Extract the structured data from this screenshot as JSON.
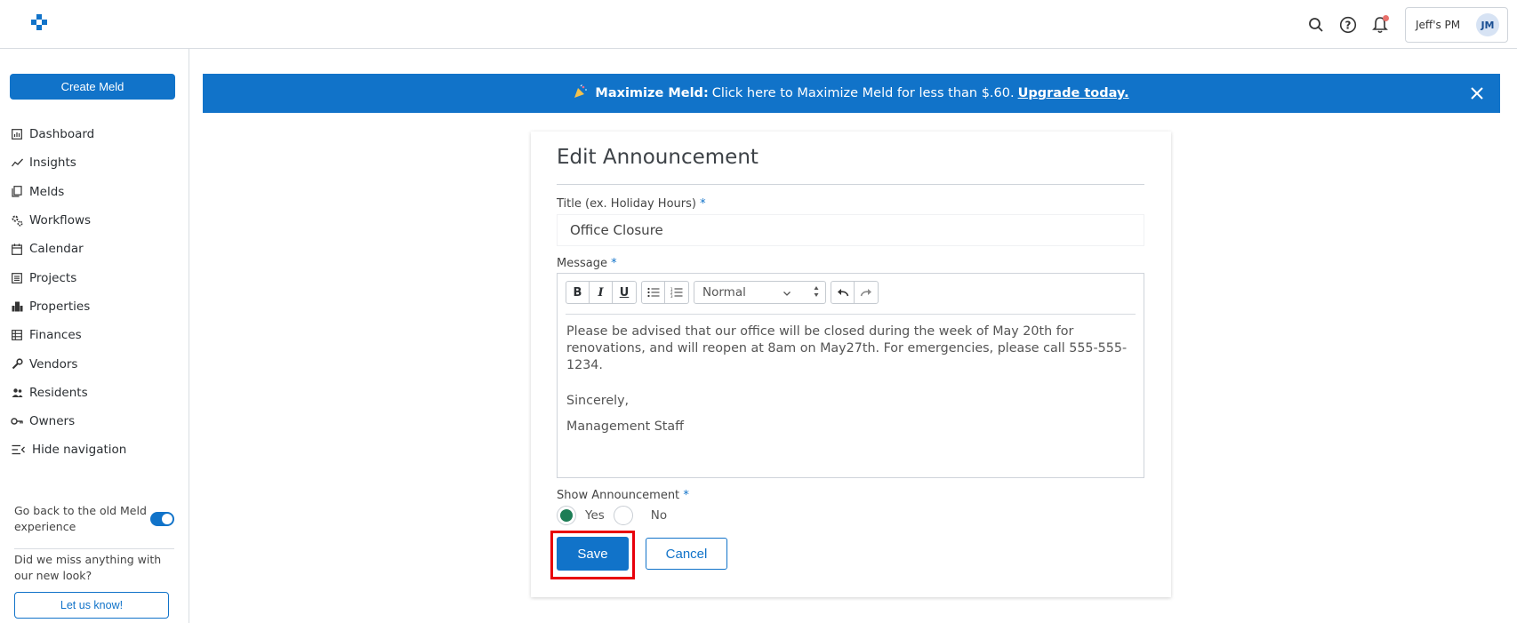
{
  "topbar": {
    "account_name": "Jeff's PM",
    "avatar_initials": "JM",
    "icons": [
      "search-icon",
      "help-icon",
      "bell-icon"
    ]
  },
  "sidebar": {
    "create_label": "Create Meld",
    "items": [
      {
        "label": "Dashboard",
        "icon": "dashboard-icon"
      },
      {
        "label": "Insights",
        "icon": "insights-icon"
      },
      {
        "label": "Melds",
        "icon": "melds-icon"
      },
      {
        "label": "Workflows",
        "icon": "workflows-icon"
      },
      {
        "label": "Calendar",
        "icon": "calendar-icon"
      },
      {
        "label": "Projects",
        "icon": "projects-icon"
      },
      {
        "label": "Properties",
        "icon": "properties-icon"
      },
      {
        "label": "Finances",
        "icon": "finances-icon"
      },
      {
        "label": "Vendors",
        "icon": "vendors-icon"
      },
      {
        "label": "Residents",
        "icon": "residents-icon"
      },
      {
        "label": "Owners",
        "icon": "owners-icon"
      },
      {
        "label": "Hide navigation",
        "icon": "hide-nav-icon"
      }
    ],
    "toggle_label": "Go back to the old Meld experience",
    "feedback_text": "Did we miss anything with our new look?",
    "feedback_button": "Let us know!"
  },
  "banner": {
    "bold": "Maximize Meld:",
    "text": "Click here to Maximize Meld for less than $.60.",
    "link": "Upgrade today."
  },
  "form": {
    "title": "Edit Announcement",
    "title_label": "Title (ex. Holiday Hours)",
    "required_mark": "*",
    "title_value": "Office Closure",
    "message_label": "Message",
    "format_select": "Normal",
    "message_paragraphs": [
      "Please be advised that our office will be closed during the week of May 20th for renovations, and will reopen at 8am on May27th. For emergencies, please call 555-555-1234.",
      "Sincerely,",
      "Management Staff"
    ],
    "show_label": "Show Announcement",
    "yes_label": "Yes",
    "no_label": "No",
    "selected": "Yes",
    "save_label": "Save",
    "cancel_label": "Cancel"
  },
  "colors": {
    "accent": "#1173c9",
    "radio_on": "#1c7d55",
    "highlight": "#e8000b"
  }
}
